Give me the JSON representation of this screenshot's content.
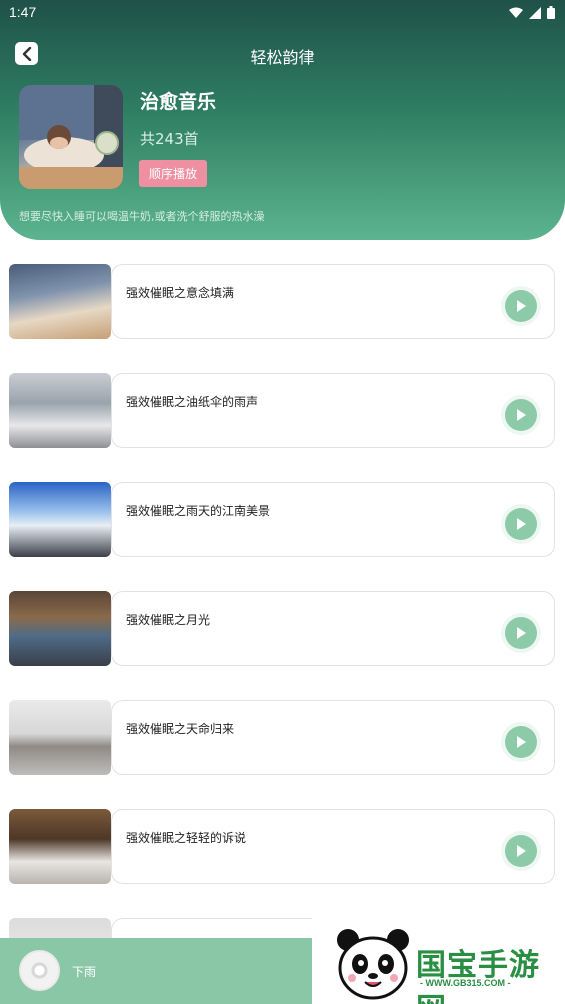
{
  "status_bar": {
    "time": "1:47"
  },
  "nav": {
    "title": "轻松韵律"
  },
  "album": {
    "title": "治愈音乐",
    "count": "共243首",
    "play_button": "顺序播放",
    "description": "想要尽快入睡可以喝温牛奶,或者洗个舒服的热水澡"
  },
  "tracks": [
    {
      "title": "强效催眠之意念填满"
    },
    {
      "title": "强效催眠之油纸伞的雨声"
    },
    {
      "title": "强效催眠之雨天的江南美景"
    },
    {
      "title": "强效催眠之月光"
    },
    {
      "title": "强效催眠之天命归来"
    },
    {
      "title": "强效催眠之轻轻的诉说"
    }
  ],
  "mini_player": {
    "title": "下雨"
  },
  "watermark": {
    "brand": "国宝手游网",
    "url": "- WWW.GB315.COM -"
  },
  "colors": {
    "accent": "#8ccaa8",
    "header_top": "#1f5148",
    "header_bottom": "#5cb48f",
    "button_pink": "#ef8fa2"
  }
}
